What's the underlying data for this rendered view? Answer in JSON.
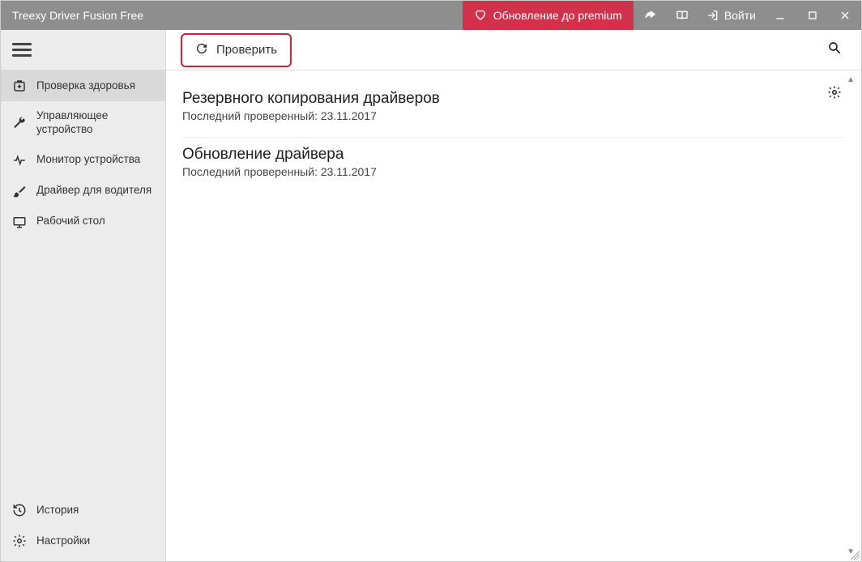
{
  "titlebar": {
    "app_title": "Treexy Driver Fusion Free",
    "premium_label": "Обновление до premium",
    "login_label": "Войти"
  },
  "sidebar": {
    "items": [
      {
        "label": "Проверка здоровья",
        "icon": "health-icon",
        "active": true
      },
      {
        "label": "Управляющее устройство",
        "icon": "wrench-icon",
        "active": false
      },
      {
        "label": "Монитор устройства",
        "icon": "activity-icon",
        "active": false
      },
      {
        "label": "Драйвер для водителя",
        "icon": "brush-icon",
        "active": false
      },
      {
        "label": "Рабочий стол",
        "icon": "desktop-icon",
        "active": false
      }
    ],
    "bottom": [
      {
        "label": "История",
        "icon": "history-icon"
      },
      {
        "label": "Настройки",
        "icon": "gear-icon"
      }
    ]
  },
  "toolbar": {
    "check_label": "Проверить"
  },
  "sections": [
    {
      "title": "Резервного копирования драйверов",
      "subtitle": "Последний проверенный: 23.11.2017"
    },
    {
      "title": "Обновление драйвера",
      "subtitle": "Последний проверенный: 23.11.2017"
    }
  ]
}
